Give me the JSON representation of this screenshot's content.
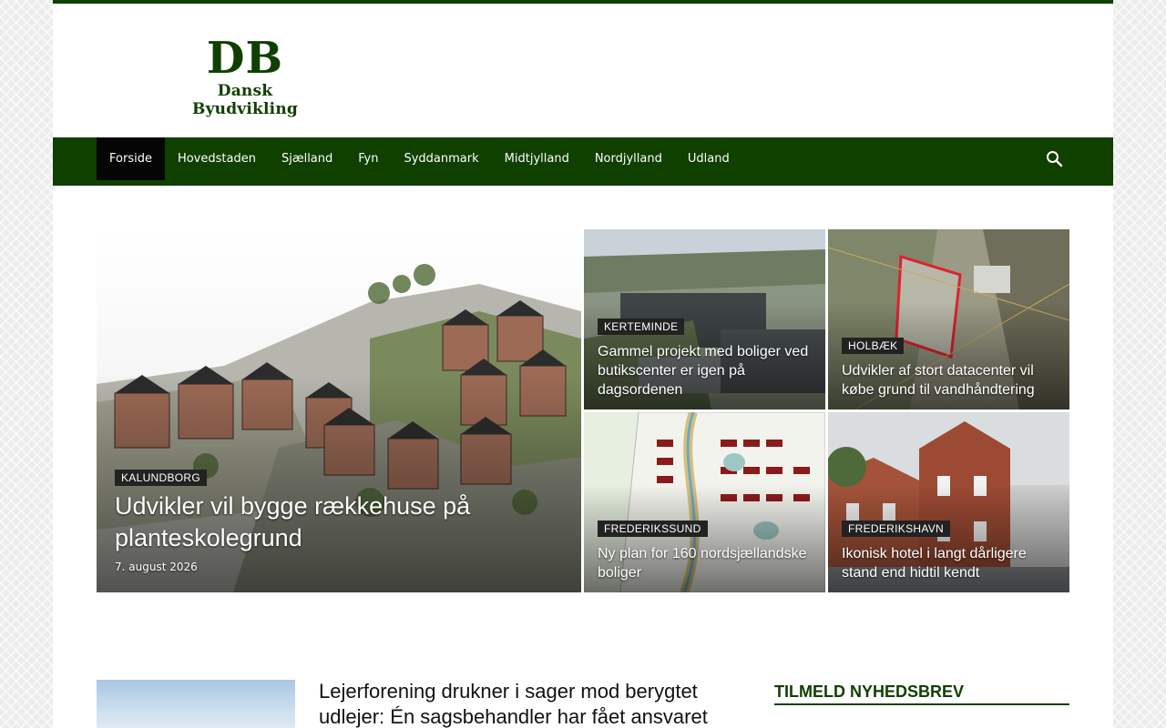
{
  "logo": {
    "mark": "DB",
    "subtitle": "Dansk Byudvikling"
  },
  "nav": {
    "items": [
      {
        "label": "Forside",
        "active": true
      },
      {
        "label": "Hovedstaden"
      },
      {
        "label": "Sjælland"
      },
      {
        "label": "Fyn"
      },
      {
        "label": "Syddanmark"
      },
      {
        "label": "Midtjylland"
      },
      {
        "label": "Nordjylland"
      },
      {
        "label": "Udland"
      }
    ],
    "search_icon": "search-icon"
  },
  "featured": {
    "main": {
      "category": "KALUNDBORG",
      "title": "Udvikler vil bygge rækkehuse på planteskolegrund",
      "date": "7. august 2026"
    },
    "tiles": [
      {
        "category": "KERTEMINDE",
        "title": "Gammel projekt med boliger ved butikscenter er igen på dagsordenen"
      },
      {
        "category": "HOLBÆK",
        "title": "Udvikler af stort datacenter vil købe grund til vandhåndtering"
      },
      {
        "category": "FREDERIKSSUND",
        "title": "Ny plan for 160 nordsjællandske boliger"
      },
      {
        "category": "FREDERIKSHAVN",
        "title": "Ikonisk hotel i langt dårligere stand end hidtil kendt"
      }
    ]
  },
  "latest": {
    "title": "Lejerforening drukner i sager mod berygtet udlejer: Én sagsbehandler har fået ansvaret"
  },
  "sidebar": {
    "newsletter_heading": "TILMELD NYHEDSBREV"
  },
  "colors": {
    "brand": "#0f4000",
    "nav_active": "#050505",
    "tag_bg": "#222222"
  }
}
